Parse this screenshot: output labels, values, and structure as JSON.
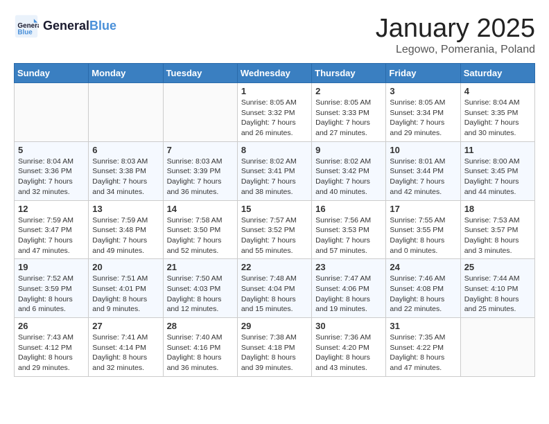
{
  "header": {
    "logo_general": "General",
    "logo_blue": "Blue",
    "month_title": "January 2025",
    "location": "Legowo, Pomerania, Poland"
  },
  "weekdays": [
    "Sunday",
    "Monday",
    "Tuesday",
    "Wednesday",
    "Thursday",
    "Friday",
    "Saturday"
  ],
  "weeks": [
    [
      {
        "day": "",
        "info": ""
      },
      {
        "day": "",
        "info": ""
      },
      {
        "day": "",
        "info": ""
      },
      {
        "day": "1",
        "info": "Sunrise: 8:05 AM\nSunset: 3:32 PM\nDaylight: 7 hours\nand 26 minutes."
      },
      {
        "day": "2",
        "info": "Sunrise: 8:05 AM\nSunset: 3:33 PM\nDaylight: 7 hours\nand 27 minutes."
      },
      {
        "day": "3",
        "info": "Sunrise: 8:05 AM\nSunset: 3:34 PM\nDaylight: 7 hours\nand 29 minutes."
      },
      {
        "day": "4",
        "info": "Sunrise: 8:04 AM\nSunset: 3:35 PM\nDaylight: 7 hours\nand 30 minutes."
      }
    ],
    [
      {
        "day": "5",
        "info": "Sunrise: 8:04 AM\nSunset: 3:36 PM\nDaylight: 7 hours\nand 32 minutes."
      },
      {
        "day": "6",
        "info": "Sunrise: 8:03 AM\nSunset: 3:38 PM\nDaylight: 7 hours\nand 34 minutes."
      },
      {
        "day": "7",
        "info": "Sunrise: 8:03 AM\nSunset: 3:39 PM\nDaylight: 7 hours\nand 36 minutes."
      },
      {
        "day": "8",
        "info": "Sunrise: 8:02 AM\nSunset: 3:41 PM\nDaylight: 7 hours\nand 38 minutes."
      },
      {
        "day": "9",
        "info": "Sunrise: 8:02 AM\nSunset: 3:42 PM\nDaylight: 7 hours\nand 40 minutes."
      },
      {
        "day": "10",
        "info": "Sunrise: 8:01 AM\nSunset: 3:44 PM\nDaylight: 7 hours\nand 42 minutes."
      },
      {
        "day": "11",
        "info": "Sunrise: 8:00 AM\nSunset: 3:45 PM\nDaylight: 7 hours\nand 44 minutes."
      }
    ],
    [
      {
        "day": "12",
        "info": "Sunrise: 7:59 AM\nSunset: 3:47 PM\nDaylight: 7 hours\nand 47 minutes."
      },
      {
        "day": "13",
        "info": "Sunrise: 7:59 AM\nSunset: 3:48 PM\nDaylight: 7 hours\nand 49 minutes."
      },
      {
        "day": "14",
        "info": "Sunrise: 7:58 AM\nSunset: 3:50 PM\nDaylight: 7 hours\nand 52 minutes."
      },
      {
        "day": "15",
        "info": "Sunrise: 7:57 AM\nSunset: 3:52 PM\nDaylight: 7 hours\nand 55 minutes."
      },
      {
        "day": "16",
        "info": "Sunrise: 7:56 AM\nSunset: 3:53 PM\nDaylight: 7 hours\nand 57 minutes."
      },
      {
        "day": "17",
        "info": "Sunrise: 7:55 AM\nSunset: 3:55 PM\nDaylight: 8 hours\nand 0 minutes."
      },
      {
        "day": "18",
        "info": "Sunrise: 7:53 AM\nSunset: 3:57 PM\nDaylight: 8 hours\nand 3 minutes."
      }
    ],
    [
      {
        "day": "19",
        "info": "Sunrise: 7:52 AM\nSunset: 3:59 PM\nDaylight: 8 hours\nand 6 minutes."
      },
      {
        "day": "20",
        "info": "Sunrise: 7:51 AM\nSunset: 4:01 PM\nDaylight: 8 hours\nand 9 minutes."
      },
      {
        "day": "21",
        "info": "Sunrise: 7:50 AM\nSunset: 4:03 PM\nDaylight: 8 hours\nand 12 minutes."
      },
      {
        "day": "22",
        "info": "Sunrise: 7:48 AM\nSunset: 4:04 PM\nDaylight: 8 hours\nand 15 minutes."
      },
      {
        "day": "23",
        "info": "Sunrise: 7:47 AM\nSunset: 4:06 PM\nDaylight: 8 hours\nand 19 minutes."
      },
      {
        "day": "24",
        "info": "Sunrise: 7:46 AM\nSunset: 4:08 PM\nDaylight: 8 hours\nand 22 minutes."
      },
      {
        "day": "25",
        "info": "Sunrise: 7:44 AM\nSunset: 4:10 PM\nDaylight: 8 hours\nand 25 minutes."
      }
    ],
    [
      {
        "day": "26",
        "info": "Sunrise: 7:43 AM\nSunset: 4:12 PM\nDaylight: 8 hours\nand 29 minutes."
      },
      {
        "day": "27",
        "info": "Sunrise: 7:41 AM\nSunset: 4:14 PM\nDaylight: 8 hours\nand 32 minutes."
      },
      {
        "day": "28",
        "info": "Sunrise: 7:40 AM\nSunset: 4:16 PM\nDaylight: 8 hours\nand 36 minutes."
      },
      {
        "day": "29",
        "info": "Sunrise: 7:38 AM\nSunset: 4:18 PM\nDaylight: 8 hours\nand 39 minutes."
      },
      {
        "day": "30",
        "info": "Sunrise: 7:36 AM\nSunset: 4:20 PM\nDaylight: 8 hours\nand 43 minutes."
      },
      {
        "day": "31",
        "info": "Sunrise: 7:35 AM\nSunset: 4:22 PM\nDaylight: 8 hours\nand 47 minutes."
      },
      {
        "day": "",
        "info": ""
      }
    ]
  ]
}
